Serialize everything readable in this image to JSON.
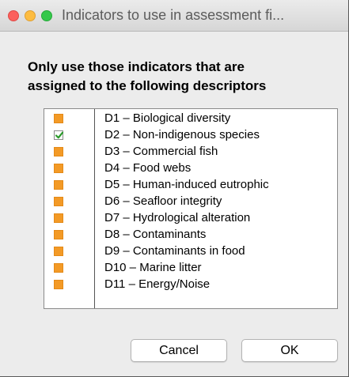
{
  "window": {
    "title": "Indicators to use in assessment fi..."
  },
  "heading": {
    "line1": "Only use those indicators that are",
    "line2": "assigned to the following descriptors"
  },
  "descriptors": [
    {
      "label": "D1 – Biological diversity",
      "checked": false
    },
    {
      "label": "D2 – Non-indigenous species",
      "checked": true
    },
    {
      "label": "D3 – Commercial fish",
      "checked": false
    },
    {
      "label": "D4 – Food webs",
      "checked": false
    },
    {
      "label": "D5 – Human-induced eutrophic",
      "checked": false
    },
    {
      "label": "D6 – Seafloor integrity",
      "checked": false
    },
    {
      "label": "D7 – Hydrological alteration",
      "checked": false
    },
    {
      "label": "D8 – Contaminants",
      "checked": false
    },
    {
      "label": "D9 – Contaminants in food",
      "checked": false
    },
    {
      "label": "D10 – Marine litter",
      "checked": false
    },
    {
      "label": "D11 – Energy/Noise",
      "checked": false
    }
  ],
  "buttons": {
    "cancel": "Cancel",
    "ok": "OK"
  },
  "colors": {
    "unchecked_box": "#f39a26",
    "checkmark": "#2a9a2a"
  }
}
